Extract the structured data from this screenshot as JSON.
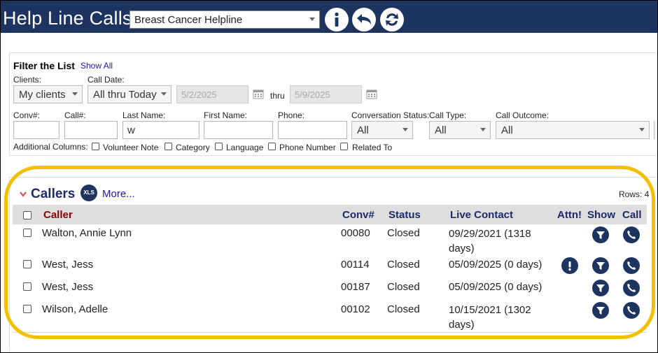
{
  "header": {
    "title": "Help Line Calls",
    "helpline_value": "Breast Cancer Helpline",
    "buttons": [
      {
        "icon": "info-icon"
      },
      {
        "icon": "back-icon"
      },
      {
        "icon": "refresh-icon"
      }
    ],
    "bar_color": "#1d3461"
  },
  "filter": {
    "heading": "Filter the List",
    "show_all": "Show All",
    "clients_label": "Clients:",
    "clients_value": "My clients",
    "call_date_label": "Call Date:",
    "call_date_value": "All thru Today",
    "date_from": "5/2/2025",
    "thru_label": "thru",
    "date_to": "5/9/2025",
    "conv_label": "Conv#:",
    "conv_value": "",
    "call_num_label": "Call#:",
    "call_num_value": "",
    "last_name_label": "Last Name:",
    "last_name_value": "w",
    "first_name_label": "First Name:",
    "first_name_value": "",
    "phone_label": "Phone:",
    "phone_value": "",
    "conv_status_label": "Conversation Status:",
    "conv_status_value": "All",
    "call_type_label": "Call Type:",
    "call_type_value": "All",
    "call_outcome_label": "Call Outcome:",
    "call_outcome_value": "All",
    "additional_label": "Additional Columns:",
    "additional_columns": [
      {
        "label": "Volunteer Note",
        "checked": false
      },
      {
        "label": "Category",
        "checked": false
      },
      {
        "label": "Language",
        "checked": false
      },
      {
        "label": "Phone Number",
        "checked": false
      },
      {
        "label": "Related To",
        "checked": false
      }
    ]
  },
  "callers": {
    "title": "Callers",
    "xls_label": "XLS",
    "more_label": "More...",
    "rows_label": "Rows: 4",
    "columns": {
      "caller": "Caller",
      "conv": "Conv#",
      "status": "Status",
      "live_contact": "Live Contact",
      "attn": "Attn!",
      "show": "Show",
      "call": "Call"
    },
    "rows": [
      {
        "caller": "Walton, Annie Lynn",
        "conv": "00080",
        "status": "Closed",
        "live_contact": "09/29/2021 (1318 days)",
        "attn": false
      },
      {
        "caller": "West, Jess",
        "conv": "00114",
        "status": "Closed",
        "live_contact": "05/09/2025 (0 days)",
        "attn": true
      },
      {
        "caller": "West, Jess",
        "conv": "00187",
        "status": "Closed",
        "live_contact": "05/09/2025 (0 days)",
        "attn": false
      },
      {
        "caller": "Wilson, Adelle",
        "conv": "00102",
        "status": "Closed",
        "live_contact": "10/15/2021 (1302 days)",
        "attn": false
      }
    ]
  },
  "colors": {
    "navy": "#1d3461",
    "caller_header": "#8b0000",
    "highlight": "#f2c000",
    "link": "#1a1aa0"
  }
}
